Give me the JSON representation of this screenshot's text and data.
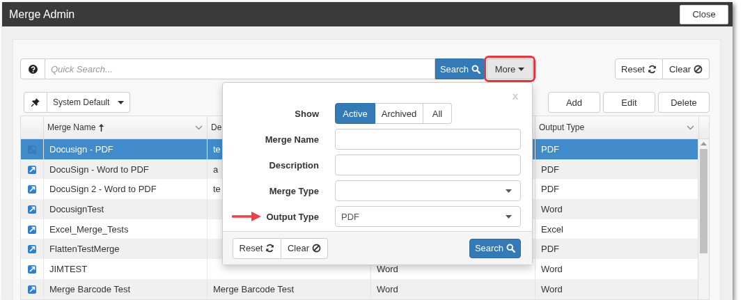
{
  "window": {
    "title": "Merge Admin",
    "close_button": "Close"
  },
  "toolbar": {
    "search_placeholder": "Quick Search...",
    "search_button": "Search",
    "more_button": {
      "label": "More",
      "highlighted": true
    },
    "reset_button": "Reset",
    "clear_button": "Clear"
  },
  "view_selector": {
    "value": "System Default"
  },
  "actions": [
    "Add",
    "Edit",
    "Delete"
  ],
  "table": {
    "columns": [
      {
        "kind": "text",
        "label": "Merge Name",
        "sorted": true,
        "menu": true
      },
      {
        "kind": "text",
        "label": "De"
      },
      {
        "kind": "covered"
      },
      {
        "kind": "text",
        "label": "Output Type",
        "sorted": false,
        "menu": true
      }
    ],
    "rows": [
      {
        "selected": true,
        "name": "Docusign - PDF",
        "description": "te",
        "output_type": "PDF"
      },
      {
        "selected": false,
        "name": "DocuSign - Word to PDF",
        "description": "a",
        "output_type": "PDF"
      },
      {
        "selected": false,
        "name": "DocuSign 2 - Word to PDF",
        "description": "te",
        "output_type": "PDF"
      },
      {
        "selected": false,
        "name": "DocusignTest",
        "output_type": "Word"
      },
      {
        "selected": false,
        "name": "Excel_Merge_Tests",
        "output_type": "Excel"
      },
      {
        "selected": false,
        "name": "FlattenTestMerge",
        "output_type": "PDF"
      },
      {
        "selected": false,
        "name": "JIMTEST",
        "merge_type": "Word",
        "output_type": "Word"
      },
      {
        "selected": false,
        "name": "Merge Barcode Test",
        "description": "Merge Barcode Test",
        "merge_type": "Word",
        "output_type": "Word"
      }
    ]
  },
  "filter_popover": {
    "close_label": "x",
    "show": {
      "label": "Show",
      "options": [
        {
          "label": "Active",
          "selected": true
        },
        {
          "label": "Archived",
          "selected": false
        },
        {
          "label": "All",
          "selected": false
        }
      ]
    },
    "fields": [
      {
        "kind": "text",
        "label": "Merge Name",
        "pointed": false
      },
      {
        "kind": "text",
        "label": "Description",
        "pointed": false
      },
      {
        "kind": "select",
        "label": "Merge Type",
        "pointed": false
      },
      {
        "kind": "select",
        "label": "Output Type",
        "value": "PDF",
        "pointed": true
      }
    ],
    "reset_button": "Reset",
    "clear_button": "Clear",
    "search_button": "Search"
  }
}
